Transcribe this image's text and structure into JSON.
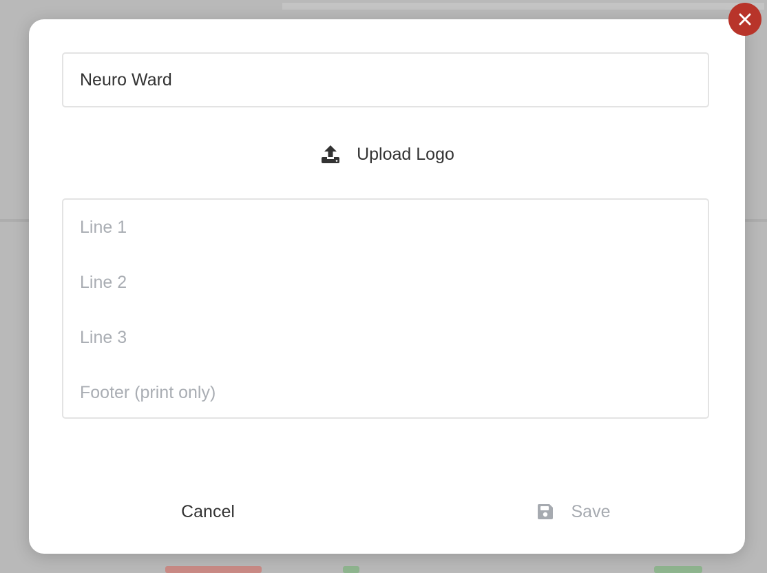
{
  "colors": {
    "close_button_bg": "#b8342a",
    "text_primary": "#333333",
    "placeholder": "#a9adb3",
    "disabled": "#a6aab0",
    "border": "#e3e3e3"
  },
  "dialog": {
    "close_icon": "close-icon",
    "name_value": "Neuro Ward",
    "upload": {
      "icon": "upload-icon",
      "label": "Upload Logo"
    },
    "lines": {
      "line1_placeholder": "Line 1",
      "line2_placeholder": "Line 2",
      "line3_placeholder": "Line 3",
      "footer_placeholder": "Footer (print only)"
    },
    "actions": {
      "cancel_label": "Cancel",
      "save_label": "Save",
      "save_icon": "floppy-disk-icon",
      "save_disabled": true
    }
  }
}
